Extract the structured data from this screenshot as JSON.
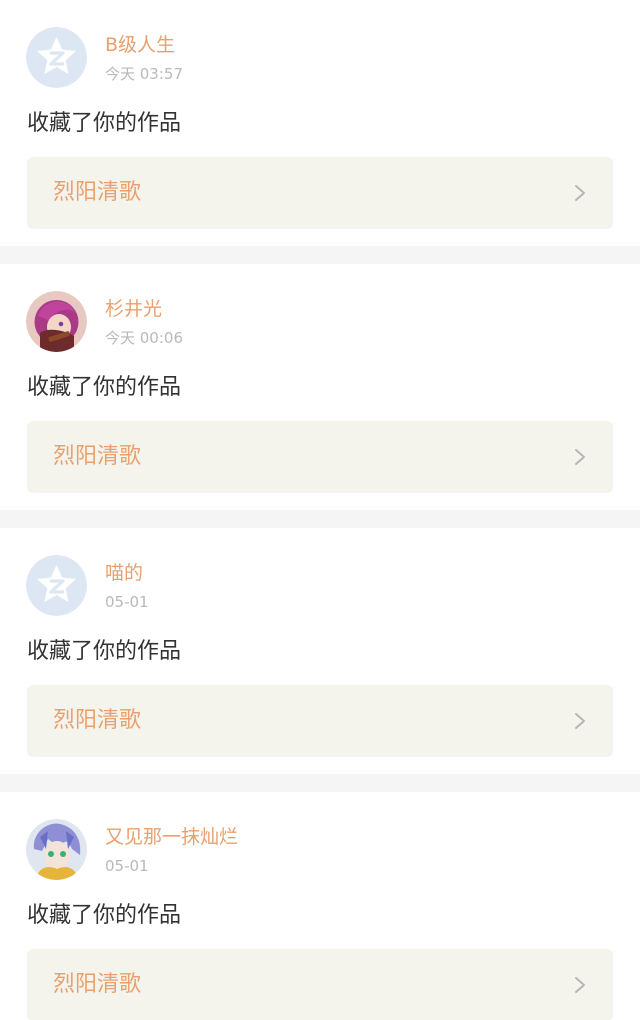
{
  "notifications": [
    {
      "username": "B级人生",
      "time": "今天 03:57",
      "action": "收藏了你的作品",
      "work_title": "烈阳清歌",
      "avatar": "default-qzone-avatar"
    },
    {
      "username": "杉井光",
      "time": "今天 00:06",
      "action": "收藏了你的作品",
      "work_title": "烈阳清歌",
      "avatar": "anime-girl-pink-hair"
    },
    {
      "username": "喵的",
      "time": "05-01",
      "action": "收藏了你的作品",
      "work_title": "烈阳清歌",
      "avatar": "default-qzone-avatar"
    },
    {
      "username": "又见那一抹灿烂",
      "time": "05-01",
      "action": "收藏了你的作品",
      "work_title": "烈阳清歌",
      "avatar": "anime-character-blue-hair"
    }
  ],
  "colors": {
    "accent": "#e9a06f",
    "background": "#f5f5f5",
    "card": "#ffffff",
    "work_box": "#f5f4ec",
    "default_avatar": "#dde7f4"
  }
}
